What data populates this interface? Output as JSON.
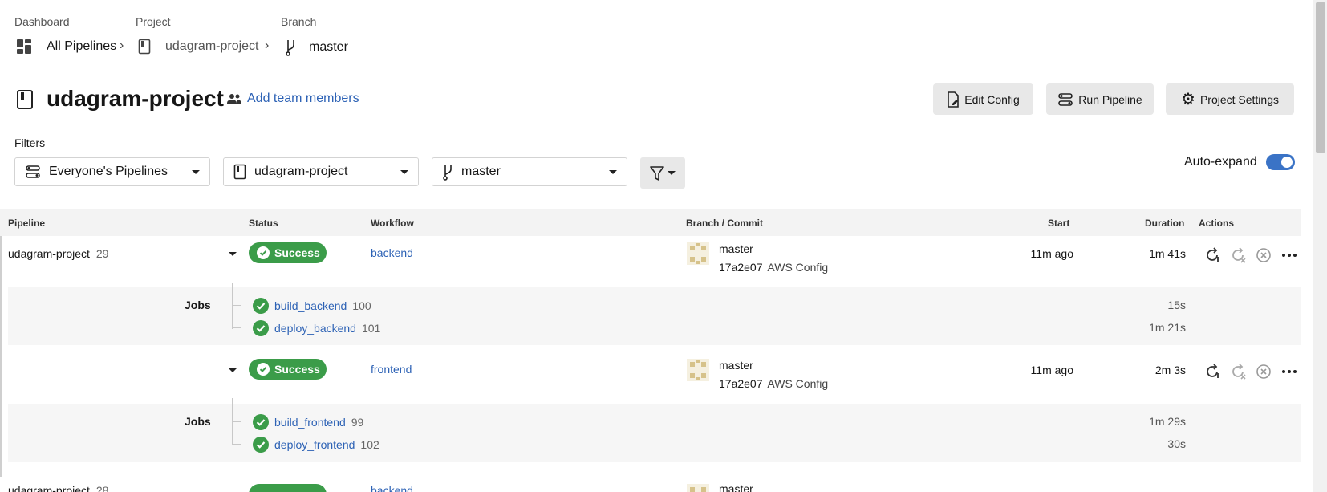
{
  "breadcrumb": {
    "dashboard_caption": "Dashboard",
    "project_caption": "Project",
    "branch_caption": "Branch",
    "all_pipelines": "All Pipelines",
    "project": "udagram-project",
    "branch": "master"
  },
  "header": {
    "title": "udagram-project",
    "add_team": "Add team members",
    "edit_config": "Edit Config",
    "run_pipeline": "Run Pipeline",
    "project_settings": "Project Settings"
  },
  "filters": {
    "label": "Filters",
    "pipelines": "Everyone's Pipelines",
    "project": "udagram-project",
    "branch": "master",
    "auto_expand": "Auto-expand",
    "auto_expand_on": true
  },
  "table": {
    "headers": {
      "pipeline": "Pipeline",
      "status": "Status",
      "workflow": "Workflow",
      "branch_commit": "Branch / Commit",
      "start": "Start",
      "duration": "Duration",
      "actions": "Actions"
    },
    "pipeline_name": "udagram-project",
    "pipeline_number": "29",
    "jobs_label": "Jobs",
    "workflows": [
      {
        "status": "Success",
        "workflow": "backend",
        "branch": "master",
        "commit_hash": "17a2e07",
        "commit_msg": "AWS Config",
        "start": "11m ago",
        "duration": "1m 41s",
        "jobs": [
          {
            "name": "build_backend",
            "number": "100",
            "duration": "15s"
          },
          {
            "name": "deploy_backend",
            "number": "101",
            "duration": "1m 21s"
          }
        ]
      },
      {
        "status": "Success",
        "workflow": "frontend",
        "branch": "master",
        "commit_hash": "17a2e07",
        "commit_msg": "AWS Config",
        "start": "11m ago",
        "duration": "2m 3s",
        "jobs": [
          {
            "name": "build_frontend",
            "number": "99",
            "duration": "1m 29s"
          },
          {
            "name": "deploy_frontend",
            "number": "102",
            "duration": "30s"
          }
        ]
      }
    ],
    "next_row": {
      "pipeline_name": "udagram-project",
      "pipeline_number": "28",
      "workflow": "backend",
      "branch": "master"
    }
  },
  "colors": {
    "success": "#3b9c49",
    "link": "#2d62b5",
    "toggle": "#3a73c6"
  }
}
